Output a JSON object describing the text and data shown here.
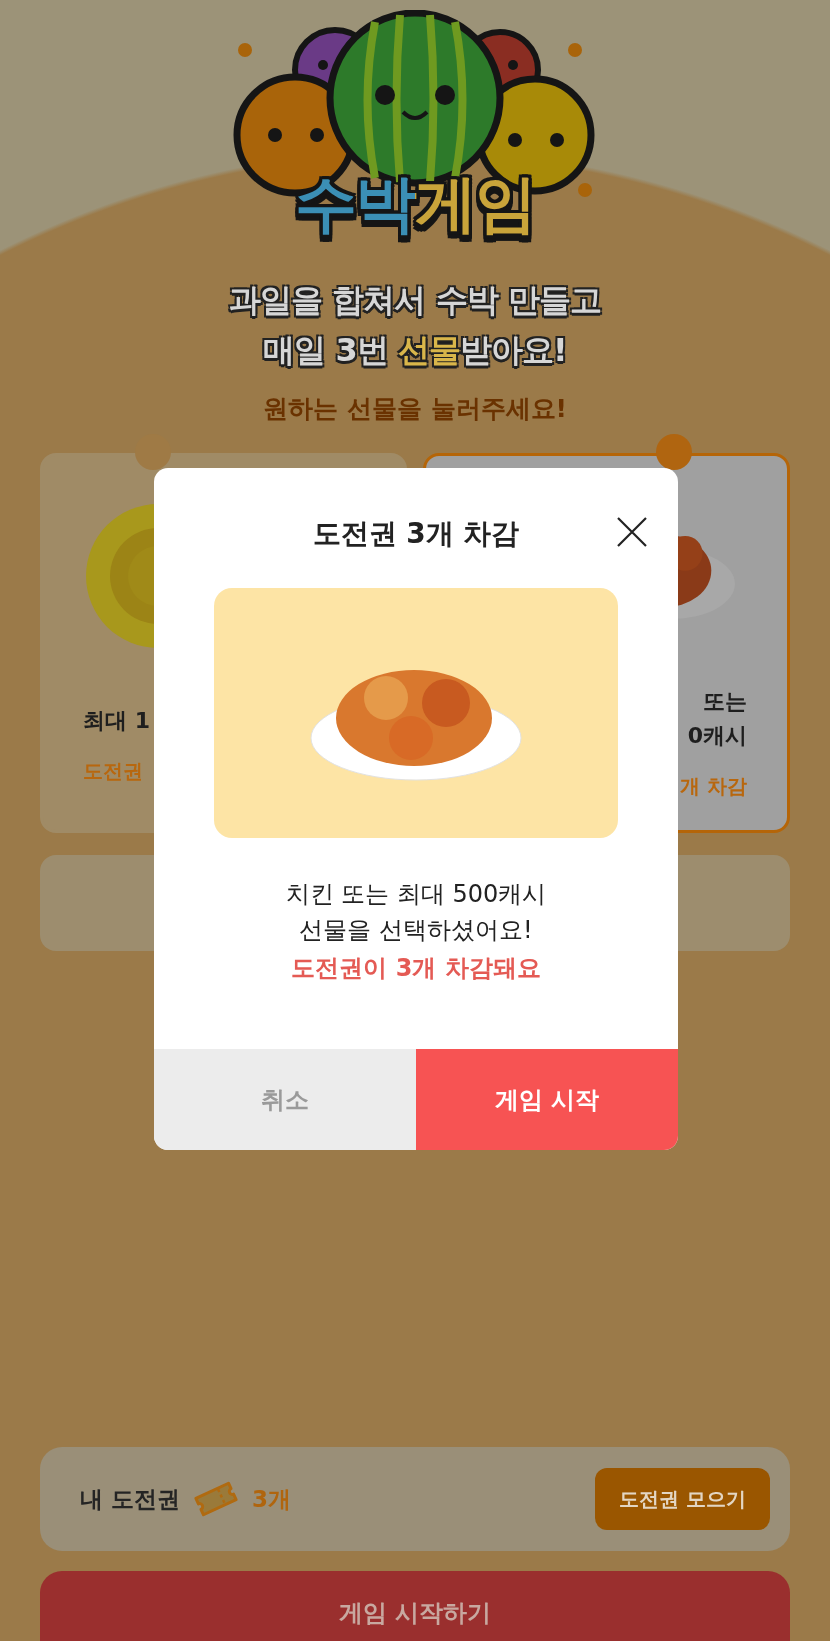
{
  "logo": {
    "title": "수박게임"
  },
  "subtitle": {
    "lines": [
      "과일을 합쳐서 수박 만들고",
      "매일 3번 **선물**받아요!"
    ]
  },
  "prompt": "원하는 선물을 눌러주세요!",
  "gift_cards": [
    {
      "kind": "coin",
      "selected": false,
      "title_lines": [
        "최대 1"
      ],
      "cost": "도전권"
    },
    {
      "kind": "chicken",
      "selected": true,
      "title_lines": [
        "또는",
        "0캐시"
      ],
      "cost": "개 차감"
    }
  ],
  "ticket_bar": {
    "label": "내 도전권",
    "count": "3개",
    "button": "도전권 모으기"
  },
  "start_button": "게임 시작하기",
  "modal": {
    "title": "도전권 3개 차감",
    "message_lines": [
      "치킨 또는 최대 500캐시",
      "선물을 선택하셨어요!"
    ],
    "warning": "도전권이 3개 차감돼요",
    "buttons": [
      {
        "kind": "cancel",
        "label": "취소"
      },
      {
        "kind": "confirm",
        "label": "게임 시작"
      }
    ]
  }
}
